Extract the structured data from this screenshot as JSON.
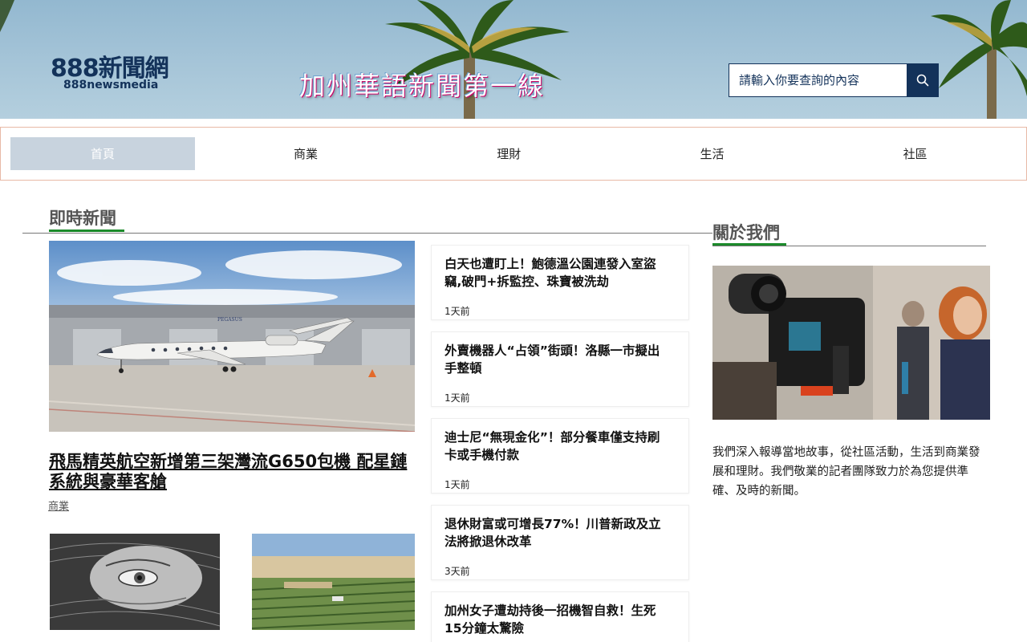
{
  "header": {
    "logo_main": "888新聞網",
    "logo_sub": "888newsmedia",
    "slogan": "加州華語新聞第一線",
    "search_placeholder": "請輸入你要查詢的內容"
  },
  "nav": {
    "items": [
      {
        "label": "首頁",
        "active": true
      },
      {
        "label": "商業",
        "active": false
      },
      {
        "label": "理財",
        "active": false
      },
      {
        "label": "生活",
        "active": false
      },
      {
        "label": "社區",
        "active": false
      }
    ]
  },
  "latest": {
    "heading": "即時新聞",
    "featured": {
      "title": "飛馬精英航空新增第三架灣流G650包機 配星鏈系統與豪華客艙",
      "category": "商業"
    },
    "news": [
      {
        "title": "白天也遭盯上！鮑德溫公園連發入室盜竊,破門+拆監控、珠寶被洗劫",
        "time": "1天前"
      },
      {
        "title": "外賣機器人“占領”街頭！洛縣一市擬出手整頓",
        "time": "1天前"
      },
      {
        "title": "迪士尼“無現金化”！部分餐車僅支持刷卡或手機付款",
        "time": "1天前"
      },
      {
        "title": "退休財富或可增長77%！川普新政及立法將掀退休改革",
        "time": "3天前"
      },
      {
        "title": "加州女子遭劫持後一招機智自救！生死15分鐘太驚險",
        "time": ""
      }
    ]
  },
  "about": {
    "heading": "關於我們",
    "text": "我們深入報導當地故事，從社區活動，生活到商業發展和理財。我們敬業的記者團隊致力於為您提供準確、及時的新聞。"
  },
  "colors": {
    "brand_navy": "#13325a",
    "accent_green": "#1b8a2a",
    "nav_active_bg": "#c8d3de",
    "nav_border": "#e8b9a6"
  }
}
